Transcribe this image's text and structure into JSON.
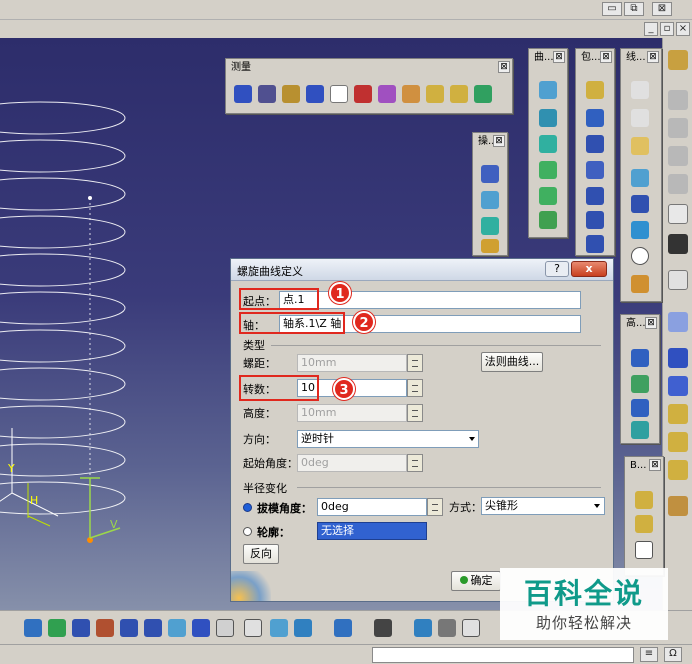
{
  "toolbars": {
    "measure": {
      "title": "测量"
    },
    "curves": {
      "title": "曲..."
    },
    "wrap": {
      "title": "包..."
    },
    "lines": {
      "title": "线..."
    },
    "ops": {
      "title": "操..."
    },
    "height": {
      "title": "高..."
    },
    "b": {
      "title": "B..."
    }
  },
  "window_controls": {
    "close": "⊠",
    "toolbar_close": "⊠"
  },
  "dialog": {
    "title": "螺旋曲线定义",
    "help": "?",
    "close": "x",
    "start_point": {
      "label": "起点：",
      "value": "点.1"
    },
    "axis": {
      "label": "轴：",
      "value": "轴系.1\\Z 轴"
    },
    "type_label": "类型",
    "pitch": {
      "label": "螺距：",
      "value": "10mm"
    },
    "law_button": "法则曲线...",
    "turns": {
      "label": "转数：",
      "value": "10"
    },
    "height": {
      "label": "高度：",
      "value": "10mm"
    },
    "direction": {
      "label": "方向：",
      "value": "逆时针"
    },
    "start_angle": {
      "label": "起始角度：",
      "value": "0deg"
    },
    "radius_label": "半径变化",
    "draft_angle": {
      "label": "拔模角度：",
      "value": "0deg"
    },
    "mode": {
      "label": "方式：",
      "value": "尖锥形"
    },
    "profile": {
      "label": "轮廓：",
      "value": "无选择"
    },
    "reverse_button": "反向",
    "ok_button": "确定"
  },
  "annotations": [
    "1",
    "2",
    "3"
  ],
  "watermark": {
    "title": "百科全说",
    "subtitle": "助你轻松解决"
  },
  "axis_labels": {
    "y": "Y",
    "h": "H",
    "v": "V"
  },
  "colors": {
    "accent_red": "#e0281e",
    "viewport_top": "#2d2d6b",
    "watermark_green": "#0f9a8a"
  }
}
